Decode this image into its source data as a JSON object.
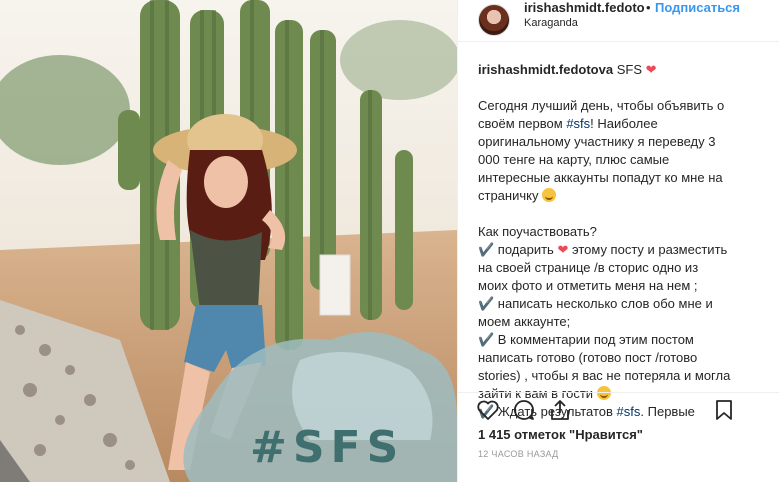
{
  "header": {
    "username": "irishashmidt.fedoto",
    "dot": "•",
    "follow_label": "Подписаться",
    "location": "Karaganda"
  },
  "caption": {
    "username": "irishashmidt.fedotova",
    "title_text": "SFS",
    "lines": [
      "Сегодня  лучший день, чтобы объявить о",
      "своём первом",
      "оригинальному участнику я переведу 3",
      "000 тенге на карту, плюс самые",
      "интересные аккаунты попадут ко мне на",
      "страничку",
      "Как поучаствовать?",
      "✔️ подарить",
      "на своей странице /в сторис одно из",
      "моих фото и отметить меня на нем ;",
      "✔️ написать несколько слов обо мне и",
      "моем аккаунте;",
      "✔️  В комментарии под этим постом",
      "написать готово (готово пост /готово",
      "stories) , чтобы я вас не потеряла и могла",
      "зайти к вам в гости",
      "✔️  Ждать результатов",
      "Первые"
    ],
    "line2_hashtag": "#sfs",
    "line2_rest": "!  Наиболее",
    "line8_rest": "  этому посту и разместить",
    "line17_hashtag": "#sfs",
    "line17_rest": ". "
  },
  "photo": {
    "overlay_text": "#SFS"
  },
  "icons": {
    "like": "heart-icon",
    "comment": "comment-icon",
    "share": "share-icon",
    "save": "bookmark-icon"
  },
  "stats": {
    "likes": "1 415 отметок \"Нравится\"",
    "time": "12 ЧАСОВ НАЗАД"
  },
  "colors": {
    "link": "#3897f0",
    "hashtag": "#003569",
    "heart": "#ed4956",
    "overlay_text": "#3f6f6e"
  }
}
